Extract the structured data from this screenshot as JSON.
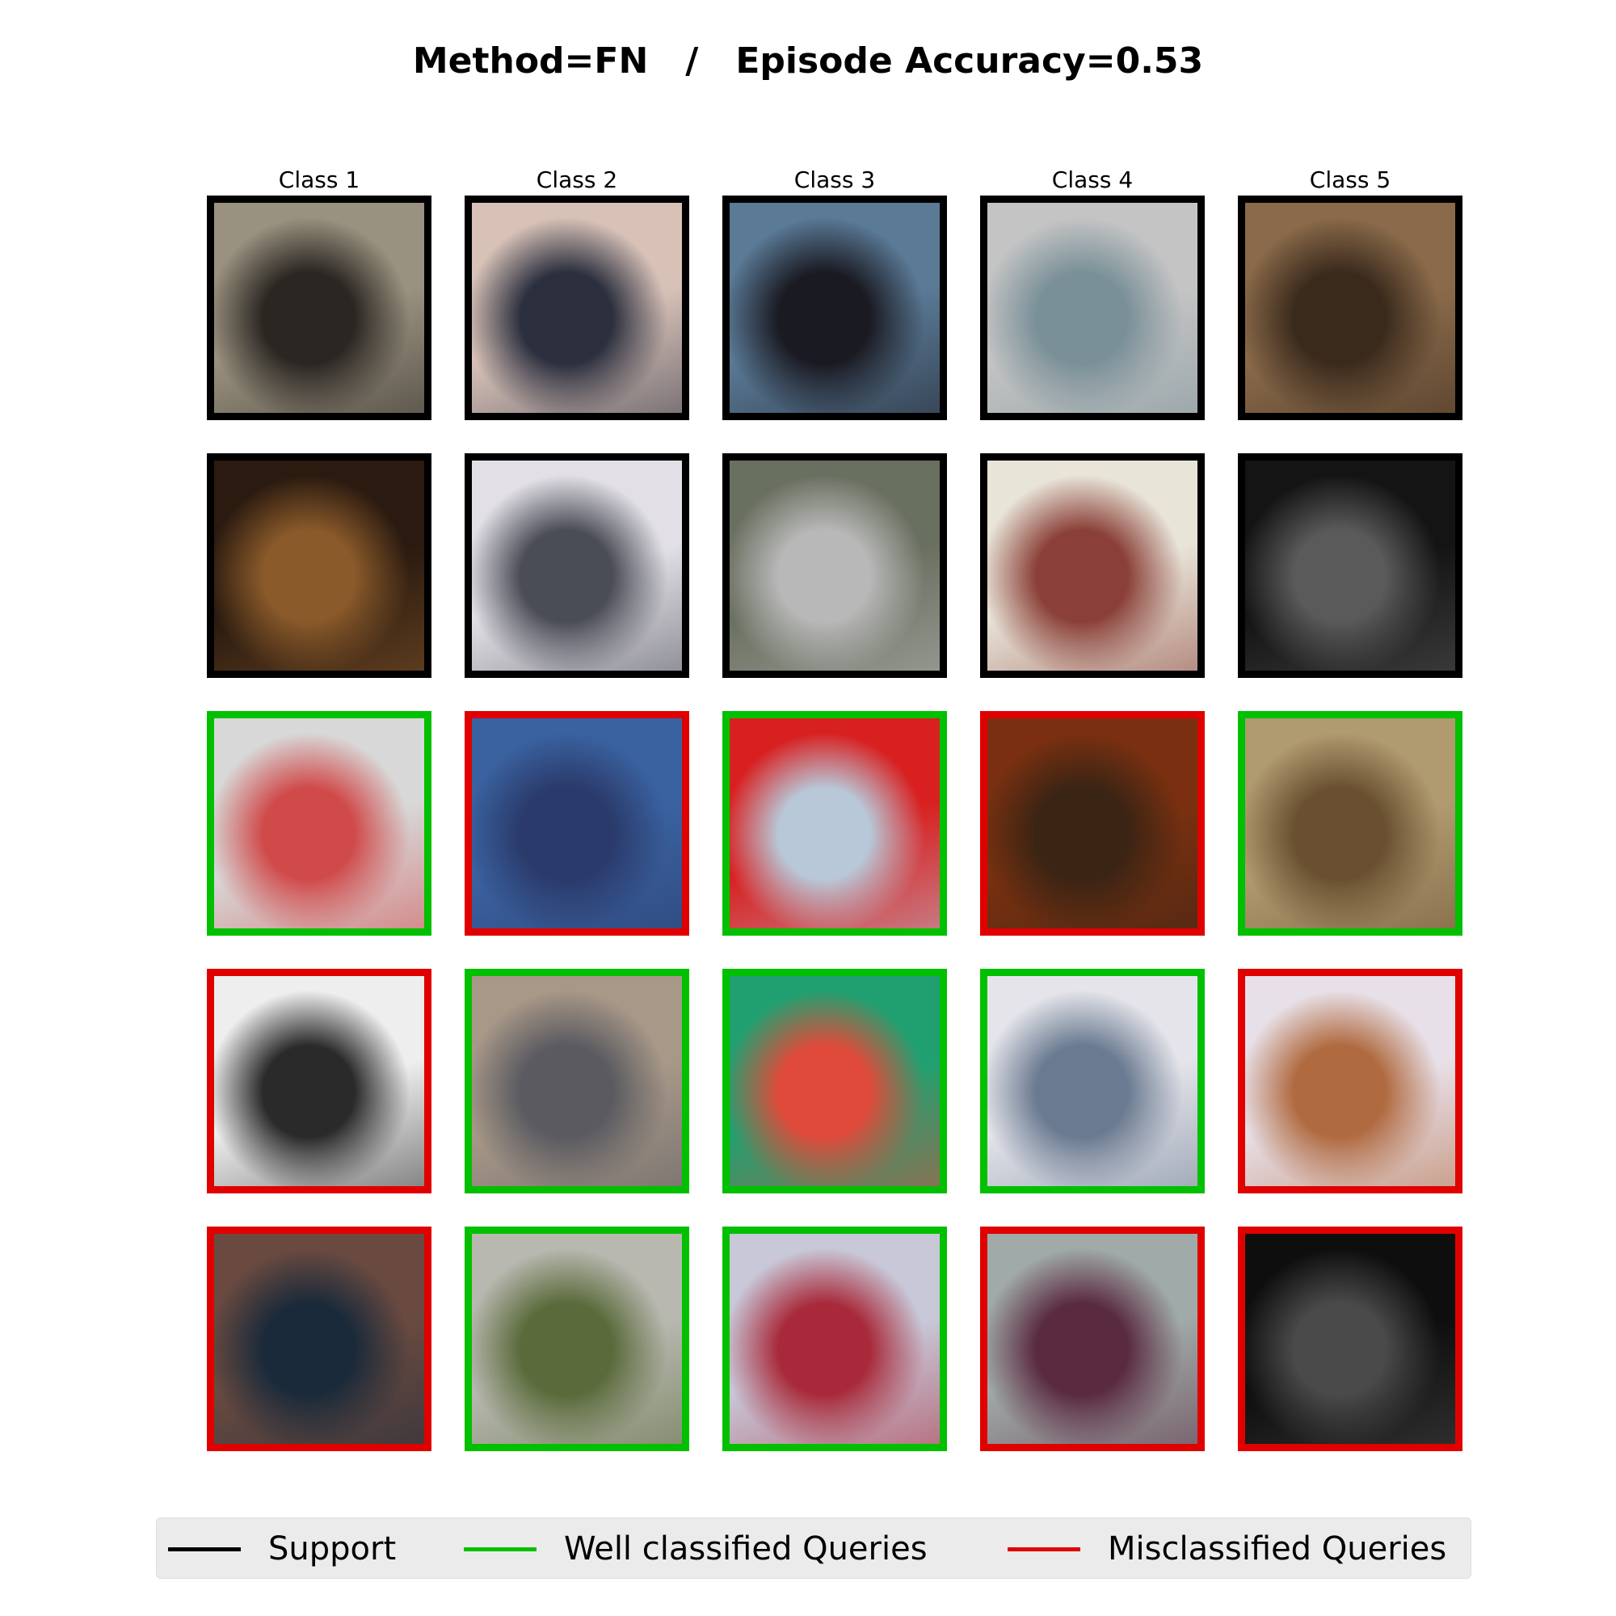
{
  "title": {
    "method": "Method=FN",
    "separator": "/",
    "accuracy": "Episode Accuracy=0.53"
  },
  "colors": {
    "support": "#000000",
    "correct": "#00c000",
    "wrong": "#e00000"
  },
  "classes": [
    "Class 1",
    "Class 2",
    "Class 3",
    "Class 4",
    "Class 5"
  ],
  "rows": [
    {
      "kind": "support",
      "tiles": [
        {
          "class": "Class 1",
          "status": "support",
          "icon": "blurry-dark-mouse-thumbnail",
          "palette": [
            "#9a9280",
            "#2a2622"
          ]
        },
        {
          "class": "Class 2",
          "status": "support",
          "icon": "airplane-takeoff-thumbnail",
          "palette": [
            "#d8c2b8",
            "#2b2f3e"
          ]
        },
        {
          "class": "Class 3",
          "status": "support",
          "icon": "bus-with-person-thumbnail",
          "palette": [
            "#5a7a96",
            "#1a1a22"
          ]
        },
        {
          "class": "Class 4",
          "status": "support",
          "icon": "blurry-gray-thumbnail",
          "palette": [
            "#c4c4c4",
            "#7a9098"
          ]
        },
        {
          "class": "Class 5",
          "status": "support",
          "icon": "steel-fridge-thumbnail",
          "palette": [
            "#8a6a4a",
            "#3a2a1c"
          ]
        }
      ]
    },
    {
      "kind": "support",
      "tiles": [
        {
          "class": "Class 1",
          "status": "support",
          "icon": "dark-brown-mouse-thumbnail",
          "palette": [
            "#2a1a10",
            "#8a5a2a"
          ]
        },
        {
          "class": "Class 2",
          "status": "support",
          "icon": "jumbo-jet-thumbnail",
          "palette": [
            "#e2e0e6",
            "#4a4c56"
          ]
        },
        {
          "class": "Class 3",
          "status": "support",
          "icon": "blurry-bus-thumbnail",
          "palette": [
            "#6a7060",
            "#b8b8b8"
          ]
        },
        {
          "class": "Class 4",
          "status": "support",
          "icon": "white-object-thumbnail",
          "palette": [
            "#e8e4d8",
            "#8a4038"
          ]
        },
        {
          "class": "Class 5",
          "status": "support",
          "icon": "dark-fridge-thumbnail",
          "palette": [
            "#141414",
            "#5a5a5a"
          ]
        }
      ]
    },
    {
      "kind": "query",
      "tiles": [
        {
          "class": "Class 1",
          "status": "correct",
          "icon": "silver-mouse-thumbnail",
          "palette": [
            "#d8d8d8",
            "#d04a4a"
          ]
        },
        {
          "class": "Class 2",
          "status": "wrong",
          "icon": "blue-blurry-plane-thumbnail",
          "palette": [
            "#3a62a0",
            "#2a3a6a"
          ]
        },
        {
          "class": "Class 3",
          "status": "correct",
          "icon": "red-double-decker-thumbnail",
          "palette": [
            "#d82020",
            "#b8c8d8"
          ]
        },
        {
          "class": "Class 4",
          "status": "wrong",
          "icon": "brown-dark-object-thumbnail",
          "palette": [
            "#7a3010",
            "#3a2414"
          ]
        },
        {
          "class": "Class 5",
          "status": "correct",
          "icon": "beige-fridge-thumbnail",
          "palette": [
            "#b09a70",
            "#6a5030"
          ]
        }
      ]
    },
    {
      "kind": "query",
      "tiles": [
        {
          "class": "Class 1",
          "status": "wrong",
          "icon": "white-mouse-thumbnail",
          "palette": [
            "#eeeeee",
            "#2a2a2a"
          ]
        },
        {
          "class": "Class 2",
          "status": "correct",
          "icon": "blurry-plane-thumbnail",
          "palette": [
            "#a89888",
            "#5a5a60"
          ]
        },
        {
          "class": "Class 3",
          "status": "correct",
          "icon": "green-red-bus-thumbnail",
          "palette": [
            "#20a070",
            "#e04a3a"
          ]
        },
        {
          "class": "Class 4",
          "status": "correct",
          "icon": "cloudy-gray-thumbnail",
          "palette": [
            "#e4e4ea",
            "#6a7a90"
          ]
        },
        {
          "class": "Class 5",
          "status": "wrong",
          "icon": "open-fridge-thumbnail",
          "palette": [
            "#e8e0e8",
            "#b06a40"
          ]
        }
      ]
    },
    {
      "kind": "query",
      "tiles": [
        {
          "class": "Class 1",
          "status": "wrong",
          "icon": "fingers-on-mouse-thumbnail",
          "palette": [
            "#6a4a40",
            "#1a2a3a"
          ]
        },
        {
          "class": "Class 2",
          "status": "correct",
          "icon": "parked-plane-thumbnail",
          "palette": [
            "#b8b8b0",
            "#5a6a3a"
          ]
        },
        {
          "class": "Class 3",
          "status": "correct",
          "icon": "pixelated-bus-thumbnail",
          "palette": [
            "#c8c8d8",
            "#a82a3a"
          ]
        },
        {
          "class": "Class 4",
          "status": "wrong",
          "icon": "blurry-purple-thumbnail",
          "palette": [
            "#a0aaa8",
            "#5a2a40"
          ]
        },
        {
          "class": "Class 5",
          "status": "wrong",
          "icon": "dark-gray-thumbnail",
          "palette": [
            "#0e0e0e",
            "#4a4a4a"
          ]
        }
      ]
    }
  ],
  "legend": {
    "support": "Support",
    "correct": "Well classified Queries",
    "wrong": "Misclassified Queries"
  }
}
